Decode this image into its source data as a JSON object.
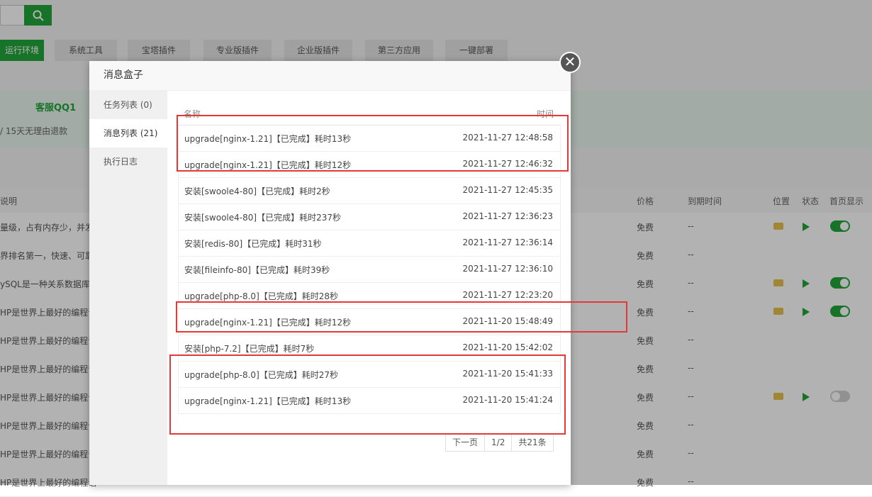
{
  "tabs": [
    {
      "label": "运行环境",
      "active": true
    },
    {
      "label": "系统工具"
    },
    {
      "label": "宝塔插件"
    },
    {
      "label": "专业版插件"
    },
    {
      "label": "企业版插件"
    },
    {
      "label": "第三方应用"
    },
    {
      "label": "一键部署"
    }
  ],
  "promo": {
    "qq": "客服QQ1",
    "refund": "/ 15天无理由退款"
  },
  "table": {
    "headers": {
      "desc": "说明",
      "price": "价格",
      "expire": "到期时间",
      "location": "位置",
      "status": "状态",
      "home": "首页显示"
    },
    "rows": [
      {
        "desc": "量级，占有内存少，并发",
        "price": "免费",
        "expire": "--"
      },
      {
        "desc": "界排名第一，快速、可靠",
        "price": "免费",
        "expire": "--"
      },
      {
        "desc": "ySQL是一种关系数据库",
        "price": "免费",
        "expire": "--"
      },
      {
        "desc": "HP是世界上最好的编程语",
        "price": "免费",
        "expire": "--"
      },
      {
        "desc": "HP是世界上最好的编程语",
        "price": "免费",
        "expire": "--"
      },
      {
        "desc": "HP是世界上最好的编程语",
        "price": "免费",
        "expire": "--"
      },
      {
        "desc": "HP是世界上最好的编程语",
        "price": "免费",
        "expire": "--"
      },
      {
        "desc": "HP是世界上最好的编程语",
        "price": "免费",
        "expire": "--"
      },
      {
        "desc": "HP是世界上最好的编程语",
        "price": "免费",
        "expire": "--"
      },
      {
        "desc": "HP是世界上最好的编程语",
        "price": "免费",
        "expire": "--"
      }
    ]
  },
  "modal": {
    "title": "消息盒子",
    "close_icon": "close-icon",
    "side_items": [
      "任务列表 (0)",
      "消息列表 (21)",
      "执行日志"
    ],
    "col_name": "名称",
    "col_time": "时间",
    "messages": [
      {
        "name": "upgrade[nginx-1.21]【已完成】耗时13秒",
        "time": "2021-11-27 12:48:58"
      },
      {
        "name": "upgrade[nginx-1.21]【已完成】耗时12秒",
        "time": "2021-11-27 12:46:32"
      },
      {
        "name": "安装[swoole4-80]【已完成】耗时2秒",
        "time": "2021-11-27 12:45:35"
      },
      {
        "name": "安装[swoole4-80]【已完成】耗时237秒",
        "time": "2021-11-27 12:36:23"
      },
      {
        "name": "安装[redis-80]【已完成】耗时31秒",
        "time": "2021-11-27 12:36:14"
      },
      {
        "name": "安装[fileinfo-80]【已完成】耗时39秒",
        "time": "2021-11-27 12:36:10"
      },
      {
        "name": "upgrade[php-8.0]【已完成】耗时28秒",
        "time": "2021-11-27 12:23:20"
      },
      {
        "name": "upgrade[nginx-1.21]【已完成】耗时12秒",
        "time": "2021-11-20 15:48:49"
      },
      {
        "name": "安装[php-7.2]【已完成】耗时7秒",
        "time": "2021-11-20 15:42:02"
      },
      {
        "name": "upgrade[php-8.0]【已完成】耗时27秒",
        "time": "2021-11-20 15:41:33"
      },
      {
        "name": "upgrade[nginx-1.21]【已完成】耗时13秒",
        "time": "2021-11-20 15:41:24"
      }
    ],
    "pager": {
      "next": "下一页",
      "page": "1/2",
      "total": "共21条"
    }
  }
}
